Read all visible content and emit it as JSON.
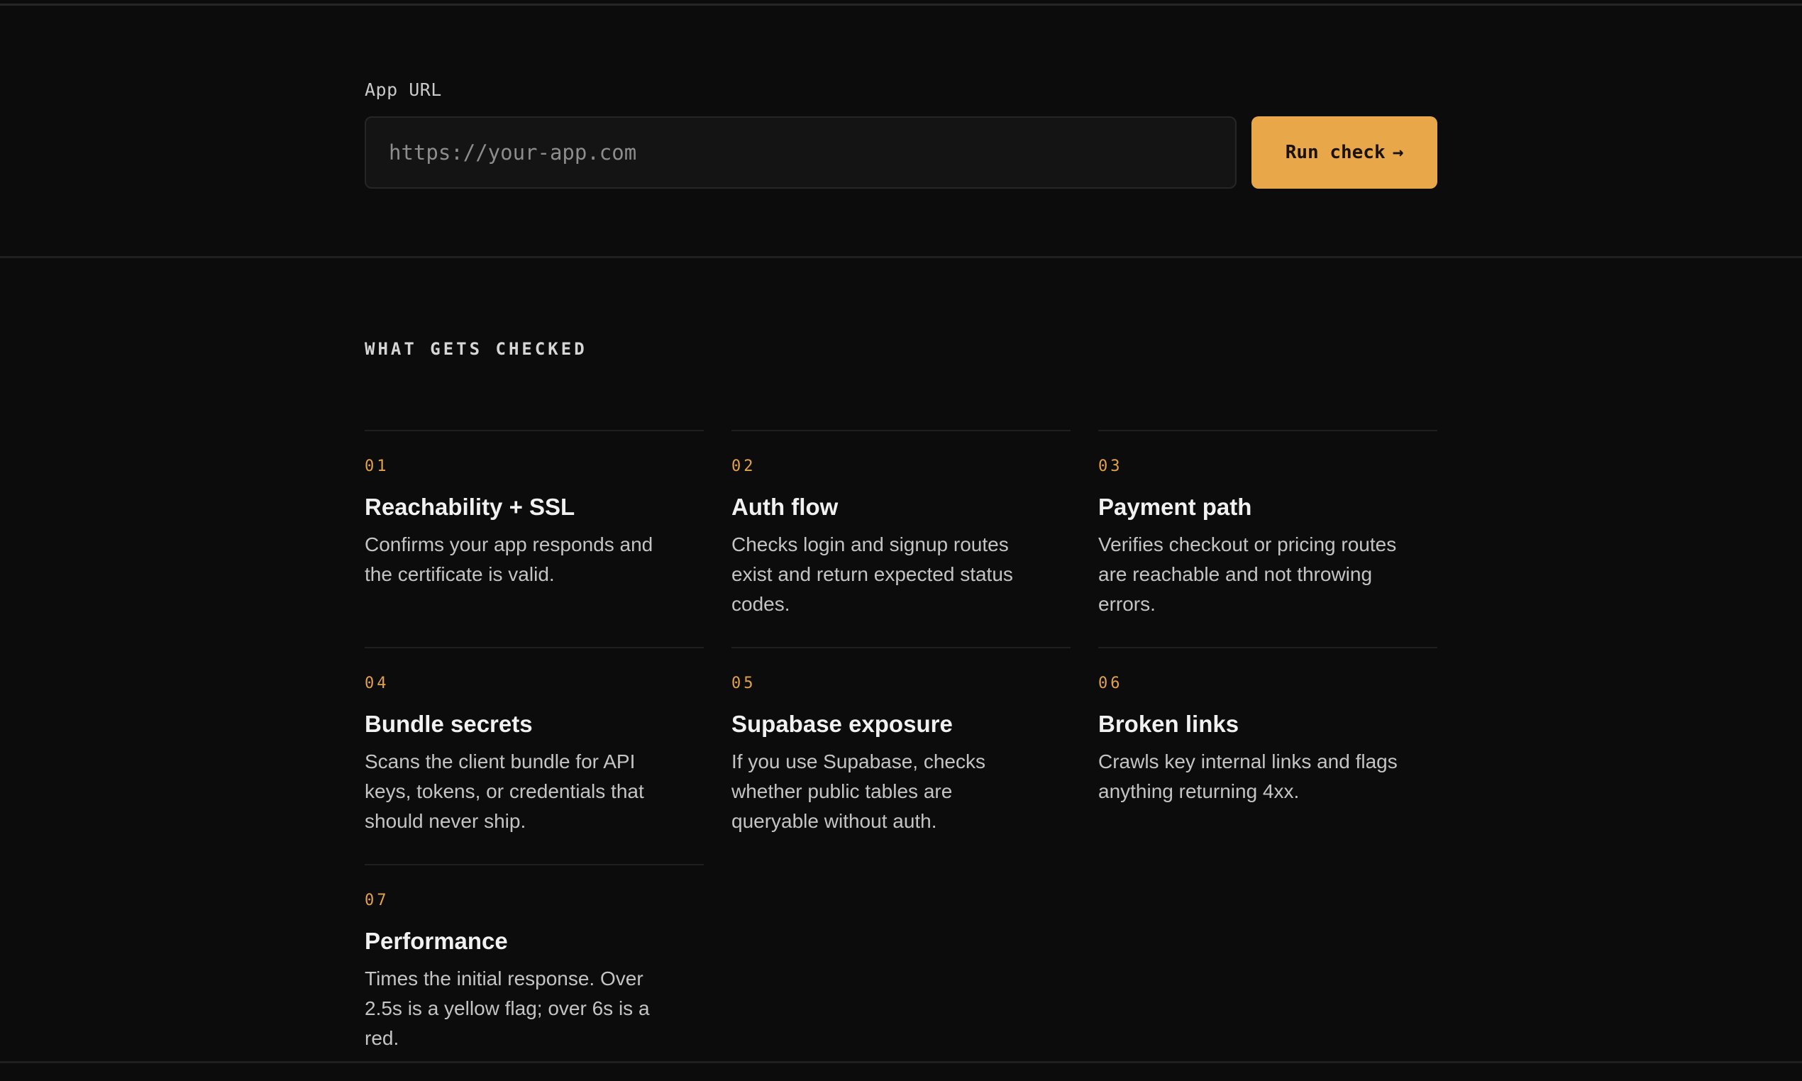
{
  "url_form": {
    "label": "App URL",
    "placeholder": "https://your-app.com",
    "value": "",
    "button_label": "Run check",
    "button_arrow": "→"
  },
  "checks": {
    "heading": "WHAT GETS CHECKED",
    "items": [
      {
        "num": "01",
        "title": "Reachability + SSL",
        "desc": "Confirms your app responds and the certificate is valid."
      },
      {
        "num": "02",
        "title": "Auth flow",
        "desc": "Checks login and signup routes exist and return expected status codes."
      },
      {
        "num": "03",
        "title": "Payment path",
        "desc": "Verifies checkout or pricing routes are reachable and not throwing errors."
      },
      {
        "num": "04",
        "title": "Bundle secrets",
        "desc": "Scans the client bundle for API keys, tokens, or credentials that should never ship."
      },
      {
        "num": "05",
        "title": "Supabase exposure",
        "desc": "If you use Supabase, checks whether public tables are queryable without auth."
      },
      {
        "num": "06",
        "title": "Broken links",
        "desc": "Crawls key internal links and flags anything returning 4xx."
      },
      {
        "num": "07",
        "title": "Performance",
        "desc": "Times the initial response. Over 2.5s is a yellow flag; over 6s is a red."
      }
    ]
  },
  "colors": {
    "background": "#0c0c0c",
    "accent": "#e8a84a",
    "number_accent": "#e2a14a"
  }
}
